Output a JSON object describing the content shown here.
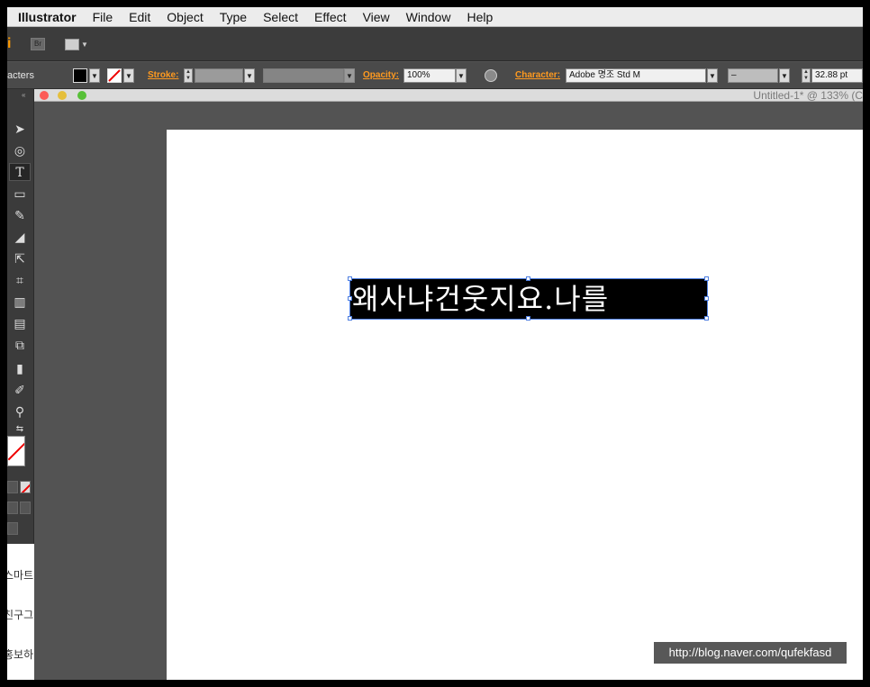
{
  "menubar": {
    "app": "Illustrator",
    "items": [
      "File",
      "Edit",
      "Object",
      "Type",
      "Select",
      "Effect",
      "View",
      "Window",
      "Help"
    ]
  },
  "appbar": {
    "logo": "i",
    "bridge": "Br"
  },
  "control": {
    "panel_label": "acters",
    "stroke_label": "Stroke:",
    "opacity_label": "Opacity:",
    "opacity_value": "100%",
    "character_label": "Character:",
    "font_value": "Adobe 명조 Std M",
    "style_value": "–",
    "size_value": "32.88 pt"
  },
  "document": {
    "title": "Untitled-1* @ 133% (C"
  },
  "artboard": {
    "text": "왜사냐건웃지요.나를"
  },
  "sidepanel": {
    "items": [
      "스마트",
      "친구그",
      "홍보하"
    ]
  },
  "watermark": "http://blog.naver.com/qufekfasd",
  "colors": {
    "accent": "#ff9a1f",
    "selection": "#4f7fe0"
  },
  "icons": [
    "selection-tool-icon",
    "lasso-tool-icon",
    "type-tool-icon",
    "rectangle-tool-icon",
    "pencil-tool-icon",
    "eraser-tool-icon",
    "scale-tool-icon",
    "free-transform-icon",
    "graph-tool-icon",
    "gradient-tool-icon",
    "shape-builder-icon",
    "column-graph-icon",
    "eyedropper-icon",
    "zoom-tool-icon",
    "swap-icon"
  ]
}
